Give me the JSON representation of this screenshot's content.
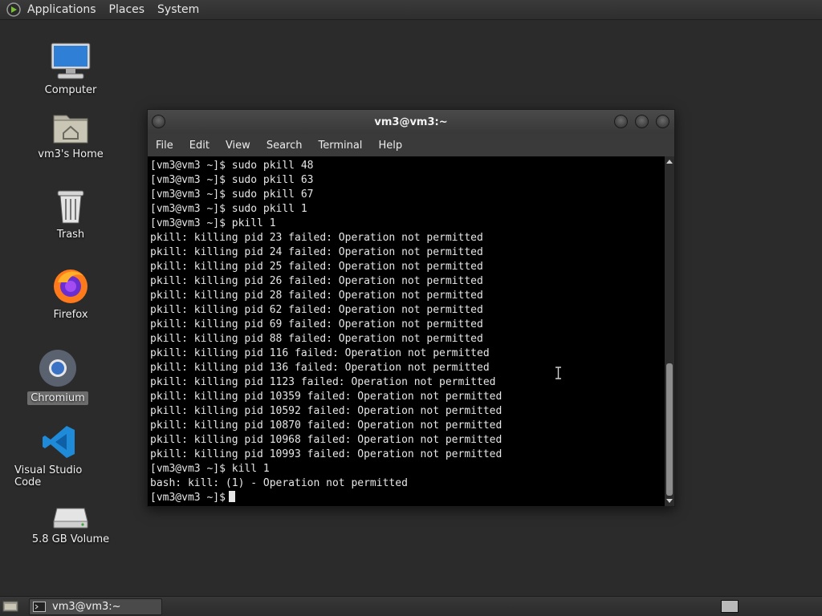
{
  "top_panel": {
    "menus": [
      "Applications",
      "Places",
      "System"
    ]
  },
  "desktop": {
    "icons": [
      {
        "label": "Computer",
        "icon": "computer-icon"
      },
      {
        "label": "vm3's Home",
        "icon": "home-folder-icon"
      },
      {
        "label": "Trash",
        "icon": "trash-icon"
      },
      {
        "label": "Firefox",
        "icon": "firefox-icon"
      },
      {
        "label": "Chromium",
        "icon": "chromium-icon",
        "selected": true
      },
      {
        "label": "Visual Studio Code",
        "icon": "vscode-icon"
      },
      {
        "label": "5.8 GB Volume",
        "icon": "drive-icon"
      }
    ]
  },
  "window": {
    "title": "vm3@vm3:~",
    "menus": [
      "File",
      "Edit",
      "View",
      "Search",
      "Terminal",
      "Help"
    ],
    "terminal_lines": [
      "[vm3@vm3 ~]$ sudo pkill 48",
      "[vm3@vm3 ~]$ sudo pkill 63",
      "[vm3@vm3 ~]$ sudo pkill 67",
      "[vm3@vm3 ~]$ sudo pkill 1",
      "[vm3@vm3 ~]$ pkill 1",
      "pkill: killing pid 23 failed: Operation not permitted",
      "pkill: killing pid 24 failed: Operation not permitted",
      "pkill: killing pid 25 failed: Operation not permitted",
      "pkill: killing pid 26 failed: Operation not permitted",
      "pkill: killing pid 28 failed: Operation not permitted",
      "pkill: killing pid 62 failed: Operation not permitted",
      "pkill: killing pid 69 failed: Operation not permitted",
      "pkill: killing pid 88 failed: Operation not permitted",
      "pkill: killing pid 116 failed: Operation not permitted",
      "pkill: killing pid 136 failed: Operation not permitted",
      "pkill: killing pid 1123 failed: Operation not permitted",
      "pkill: killing pid 10359 failed: Operation not permitted",
      "pkill: killing pid 10592 failed: Operation not permitted",
      "pkill: killing pid 10870 failed: Operation not permitted",
      "pkill: killing pid 10968 failed: Operation not permitted",
      "pkill: killing pid 10993 failed: Operation not permitted",
      "[vm3@vm3 ~]$ kill 1",
      "bash: kill: (1) - Operation not permitted"
    ],
    "prompt": "[vm3@vm3 ~]$"
  },
  "taskbar": {
    "task_label": "vm3@vm3:~"
  },
  "colors": {
    "desktop_bg": "#2b2b2b",
    "terminal_bg": "#000000",
    "terminal_fg": "#e6e6e6",
    "vscode_blue": "#1f8ad8",
    "firefox_orange": "#ff7a1a"
  }
}
